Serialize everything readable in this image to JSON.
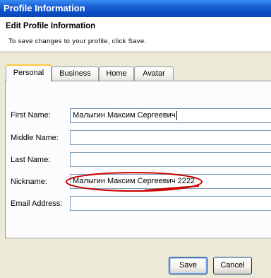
{
  "window": {
    "title": "Profile Information"
  },
  "header": {
    "title": "Edit Profile Information",
    "description": "To save changes to your profile, click Save."
  },
  "tabs": [
    {
      "label": "Personal",
      "active": true
    },
    {
      "label": "Business",
      "active": false
    },
    {
      "label": "Home",
      "active": false
    },
    {
      "label": "Avatar",
      "active": false
    }
  ],
  "form": {
    "first_name": {
      "label": "First Name:",
      "value": "Малыгин Максим Сергеевич"
    },
    "middle_name": {
      "label": "Middle Name:",
      "value": ""
    },
    "last_name": {
      "label": "Last Name:",
      "value": ""
    },
    "nickname": {
      "label": "Nickname:",
      "value": "Малыгин Максим Сергеевич 2222"
    },
    "email": {
      "label": "Email Address:",
      "value": ""
    }
  },
  "buttons": {
    "save": "Save",
    "cancel": "Cancel"
  },
  "colors": {
    "titlebar": "#0a4ec6",
    "annotation": "#cc0000",
    "active_tab_accent": "#ffc83c"
  }
}
